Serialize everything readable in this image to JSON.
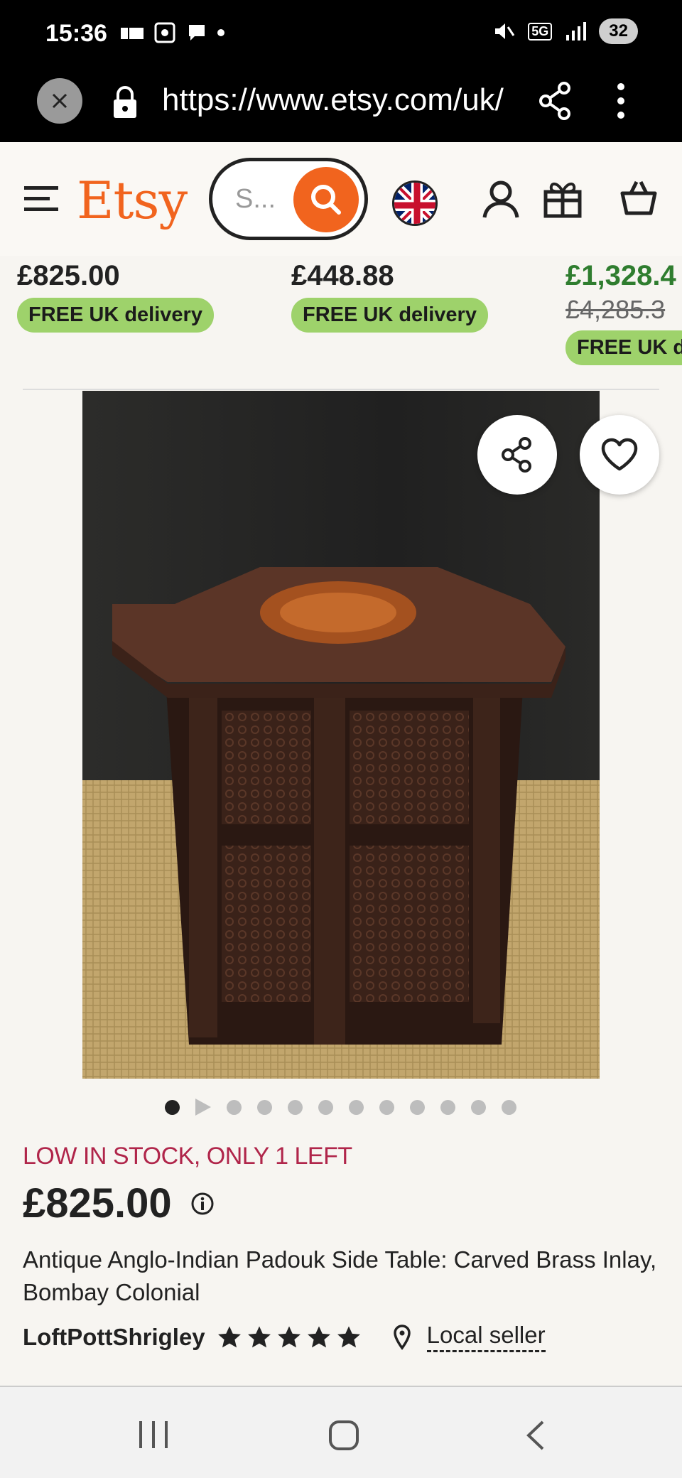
{
  "status_bar": {
    "time": "15:36",
    "battery": "32",
    "network": "5G"
  },
  "browser": {
    "url": "https://www.etsy.com/uk/",
    "icons": [
      "close-icon",
      "lock-icon",
      "share-icon",
      "more-vert-icon"
    ]
  },
  "header": {
    "logo": "Etsy",
    "search_placeholder": "S...",
    "icons": [
      "menu-icon",
      "search-icon",
      "uk-flag-icon",
      "user-icon",
      "gift-icon",
      "bag-icon"
    ],
    "brand_color": "#f1641e"
  },
  "related_items": [
    {
      "price": "£825.00",
      "delivery": "FREE UK delivery"
    },
    {
      "price": "£448.88",
      "delivery": "FREE UK delivery"
    },
    {
      "price": "£1,328.4",
      "original_price": "£4,285.3",
      "delivery": "FREE UK d"
    }
  ],
  "product": {
    "stock_notice": "LOW IN STOCK, ONLY 1 LEFT",
    "price": "£825.00",
    "title": "Antique Anglo-Indian Padouk Side Table: Carved Brass Inlay, Bombay Colonial",
    "seller": "LoftPottShrigley",
    "rating": 5,
    "location_label": "Local seller",
    "image_count": 12,
    "active_image_index": 0
  },
  "colors": {
    "stock_red": "#b0254a",
    "badge_green": "#9ed26b",
    "sale_green": "#2f7d2f"
  }
}
